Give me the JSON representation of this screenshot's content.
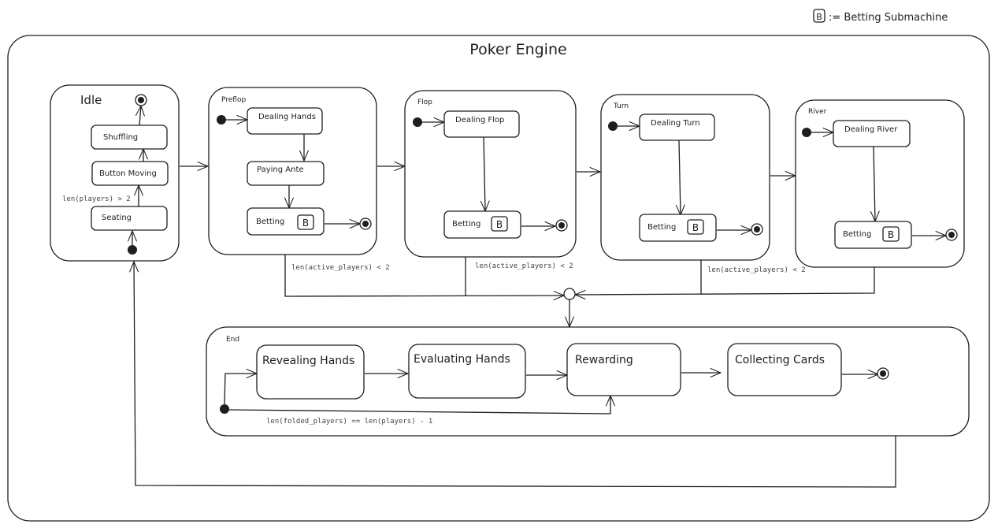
{
  "legend": {
    "badge": "B",
    "text": ":= Betting Submachine"
  },
  "title": "Poker Engine",
  "idle": {
    "label": "Idle",
    "states": [
      "Shuffling",
      "Button Moving",
      "Seating"
    ],
    "guard": "len(players) > 2"
  },
  "preflop": {
    "label": "Preflop",
    "states": [
      "Dealing Hands",
      "Paying Ante",
      "Betting"
    ],
    "badge": "B"
  },
  "flop": {
    "label": "Flop",
    "states": [
      "Dealing Flop",
      "Betting"
    ],
    "badge": "B"
  },
  "turn": {
    "label": "Turn",
    "states": [
      "Dealing Turn",
      "Betting"
    ],
    "badge": "B"
  },
  "river": {
    "label": "River",
    "states": [
      "Dealing River",
      "Betting"
    ],
    "badge": "B"
  },
  "guards": {
    "preflop_exit": "len(active_players) < 2",
    "flop_exit": "len(active_players) < 2",
    "turn_exit": "len(active_players) < 2"
  },
  "end": {
    "label": "End",
    "states": [
      "Revealing Hands",
      "Evaluating Hands",
      "Rewarding",
      "Collecting Cards"
    ],
    "guard": "len(folded_players) == len(players) - 1"
  }
}
